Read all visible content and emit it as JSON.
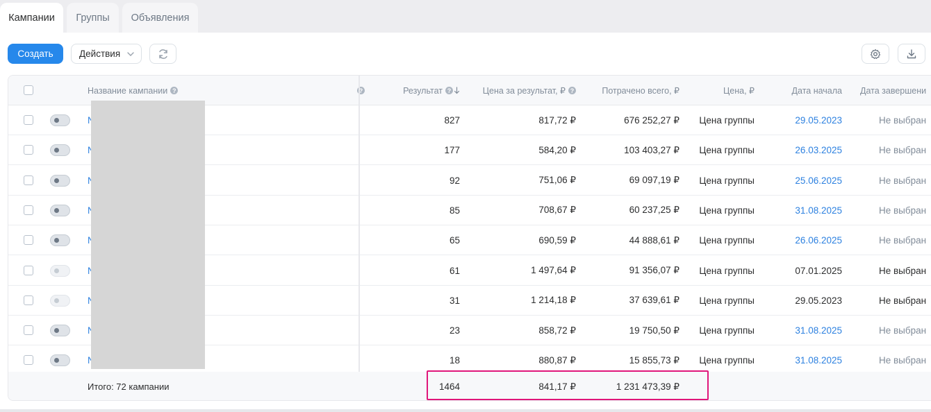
{
  "tabs": [
    {
      "label": "Кампании",
      "active": true
    },
    {
      "label": "Группы",
      "active": false
    },
    {
      "label": "Объявления",
      "active": false
    }
  ],
  "toolbar": {
    "create_label": "Создать",
    "actions_label": "Действия"
  },
  "colors": {
    "accent": "#2688eb",
    "link": "#2d81e0",
    "highlight_border": "#e0167a"
  },
  "columns": {
    "name": "Название кампании",
    "result": "Результат",
    "price_per_result": "Цена за результат, ₽",
    "spent_total": "Потрачено всего, ₽",
    "price": "Цена, ₽",
    "start_date": "Дата начала",
    "end_date": "Дата завершени"
  },
  "rows": [
    {
      "name_initial": "N",
      "toggle": "on",
      "result": "827",
      "price_per_result": "817,72 ₽",
      "spent_total": "676 252,27 ₽",
      "price": "Цена группы",
      "start_date": "29.05.2023",
      "end_date": "Не выбран"
    },
    {
      "name_initial": "N",
      "toggle": "on",
      "result": "177",
      "price_per_result": "584,20 ₽",
      "spent_total": "103 403,27 ₽",
      "price": "Цена группы",
      "start_date": "26.03.2025",
      "end_date": "Не выбран"
    },
    {
      "name_initial": "N",
      "toggle": "on",
      "result": "92",
      "price_per_result": "751,06 ₽",
      "spent_total": "69 097,19 ₽",
      "price": "Цена группы",
      "start_date": "25.06.2025",
      "end_date": "Не выбран"
    },
    {
      "name_initial": "N",
      "toggle": "on",
      "result": "85",
      "price_per_result": "708,67 ₽",
      "spent_total": "60 237,25 ₽",
      "price": "Цена группы",
      "start_date": "31.08.2025",
      "end_date": "Не выбран"
    },
    {
      "name_initial": "N",
      "toggle": "on",
      "result": "65",
      "price_per_result": "690,59 ₽",
      "spent_total": "44 888,61 ₽",
      "price": "Цена группы",
      "start_date": "26.06.2025",
      "end_date": "Не выбран"
    },
    {
      "name_initial": "N",
      "toggle": "off",
      "result": "61",
      "price_per_result": "1 497,64 ₽",
      "spent_total": "91 356,07 ₽",
      "price": "Цена группы",
      "start_date": "07.01.2025",
      "end_date": "Не выбран"
    },
    {
      "name_initial": "N",
      "toggle": "off",
      "result": "31",
      "price_per_result": "1 214,18 ₽",
      "spent_total": "37 639,61 ₽",
      "price": "Цена группы",
      "start_date": "29.05.2023",
      "end_date": "Не выбран"
    },
    {
      "name_initial": "N",
      "toggle": "on",
      "result": "23",
      "price_per_result": "858,72 ₽",
      "spent_total": "19 750,50 ₽",
      "price": "Цена группы",
      "start_date": "31.08.2025",
      "end_date": "Не выбран"
    },
    {
      "name_initial": "N",
      "toggle": "on",
      "result": "18",
      "price_per_result": "880,87 ₽",
      "spent_total": "15 855,73 ₽",
      "price": "Цена группы",
      "start_date": "31.08.2025",
      "end_date": "Не выбран"
    }
  ],
  "totals": {
    "label": "Итого: 72 кампании",
    "result": "1464",
    "price_per_result": "841,17 ₽",
    "spent_total": "1 231 473,39 ₽"
  }
}
